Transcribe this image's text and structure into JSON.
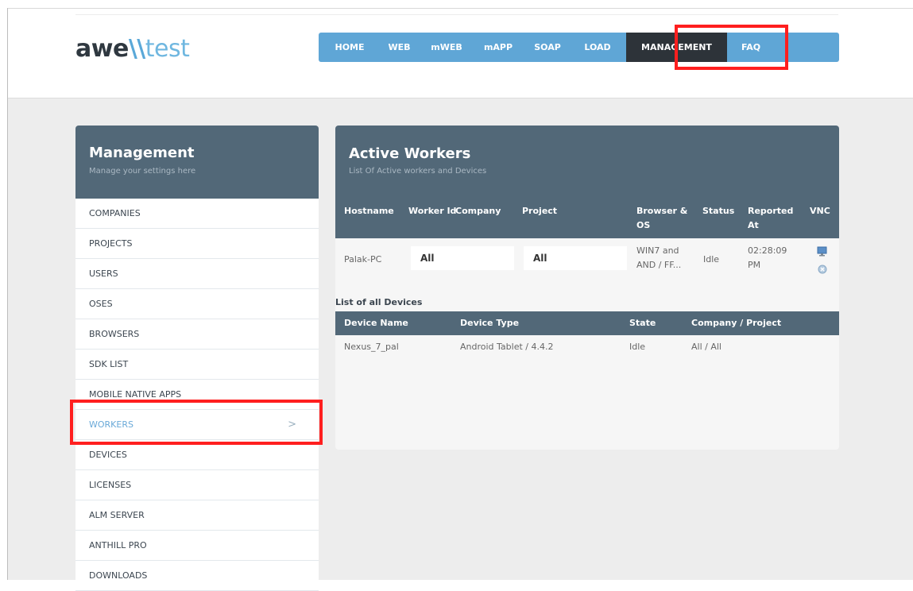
{
  "logo": {
    "part1": "awe",
    "part2": "\\\\",
    "part3": "test"
  },
  "nav": {
    "items": [
      "HOME",
      "WEB",
      "mWEB",
      "mAPP",
      "SOAP",
      "LOAD",
      "MANAGEMENT",
      "FAQ"
    ],
    "active": "MANAGEMENT"
  },
  "sidebar": {
    "title": "Management",
    "subtitle": "Manage your settings here",
    "items": [
      "COMPANIES",
      "PROJECTS",
      "USERS",
      "OSES",
      "BROWSERS",
      "SDK LIST",
      "MOBILE NATIVE APPS",
      "WORKERS",
      "DEVICES",
      "LICENSES",
      "ALM SERVER",
      "ANTHILL PRO",
      "DOWNLOADS"
    ],
    "active": "WORKERS",
    "chevron": ">"
  },
  "workers": {
    "title": "Active Workers",
    "subtitle": "List Of Active workers and Devices",
    "headers": {
      "hostname": "Hostname",
      "worker_id": "Worker Id",
      "company": "Company",
      "project": "Project",
      "browser_os_1": "Browser &",
      "browser_os_2": "OS",
      "status": "Status",
      "reported_1": "Reported",
      "reported_2": "At",
      "vnc": "VNC"
    },
    "row": {
      "hostname": "Palak-PC",
      "company": "All",
      "project": "All",
      "browser_1": "WIN7 and",
      "browser_2": "AND / FF...",
      "status": "Idle",
      "reported_1": "02:28:09",
      "reported_2": "PM"
    }
  },
  "devices": {
    "title": "List of all Devices",
    "headers": {
      "name": "Device Name",
      "type": "Device Type",
      "state": "State",
      "company": "Company / Project"
    },
    "row": {
      "name": "Nexus_7_pal",
      "type": "Android Tablet / 4.4.2",
      "state": "Idle",
      "company": "All / All"
    }
  },
  "colors": {
    "accent": "#5fa6d6",
    "header": "#526878",
    "active_nav": "#2d3339",
    "highlight": "#ff1f1f"
  }
}
